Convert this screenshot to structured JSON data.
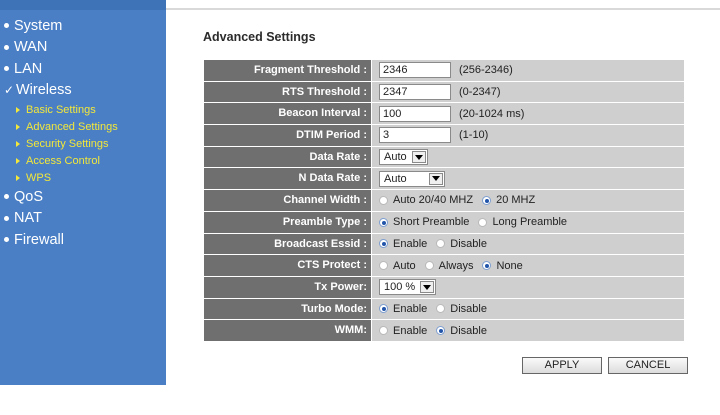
{
  "sidebar": {
    "items": [
      {
        "label": "System",
        "marker": "bullet"
      },
      {
        "label": "WAN",
        "marker": "bullet"
      },
      {
        "label": "LAN",
        "marker": "bullet"
      },
      {
        "label": "Wireless",
        "marker": "check"
      },
      {
        "label": "QoS",
        "marker": "bullet"
      },
      {
        "label": "NAT",
        "marker": "bullet"
      },
      {
        "label": "Firewall",
        "marker": "bullet"
      }
    ],
    "wireless_sub": [
      "Basic Settings",
      "Advanced Settings",
      "Security Settings",
      "Access Control",
      "WPS"
    ],
    "check_glyph": "✓"
  },
  "page_title": "Advanced Settings",
  "fields": {
    "fragment": {
      "label": "Fragment Threshold :",
      "value": "2346",
      "hint": "(256-2346)"
    },
    "rts": {
      "label": "RTS Threshold :",
      "value": "2347",
      "hint": "(0-2347)"
    },
    "beacon": {
      "label": "Beacon Interval :",
      "value": "100",
      "hint": "(20-1024 ms)"
    },
    "dtim": {
      "label": "DTIM Period :",
      "value": "3",
      "hint": "(1-10)"
    },
    "data_rate": {
      "label": "Data Rate :",
      "selected": "Auto"
    },
    "n_data_rate": {
      "label": "N Data Rate :",
      "selected": "Auto"
    },
    "channel_width": {
      "label": "Channel Width :",
      "options": [
        "Auto 20/40 MHZ",
        "20 MHZ"
      ],
      "selected": "20 MHZ"
    },
    "preamble": {
      "label": "Preamble Type :",
      "options": [
        "Short Preamble",
        "Long Preamble"
      ],
      "selected": "Short Preamble"
    },
    "broadcast": {
      "label": "Broadcast Essid :",
      "options": [
        "Enable",
        "Disable"
      ],
      "selected": "Enable"
    },
    "cts": {
      "label": "CTS Protect :",
      "options": [
        "Auto",
        "Always",
        "None"
      ],
      "selected": "None"
    },
    "tx_power": {
      "label": "Tx Power:",
      "selected": "100 %"
    },
    "turbo": {
      "label": "Turbo Mode:",
      "options": [
        "Enable",
        "Disable"
      ],
      "selected": "Enable"
    },
    "wmm": {
      "label": "WMM:",
      "options": [
        "Enable",
        "Disable"
      ],
      "selected": "Disable"
    }
  },
  "buttons": {
    "apply": "APPLY",
    "cancel": "CANCEL"
  },
  "colors": {
    "sidebar": "#4a7fc5",
    "submenu": "#f3e73a",
    "label_bg": "#6f6f6f",
    "value_bg": "#cfcfcf"
  }
}
